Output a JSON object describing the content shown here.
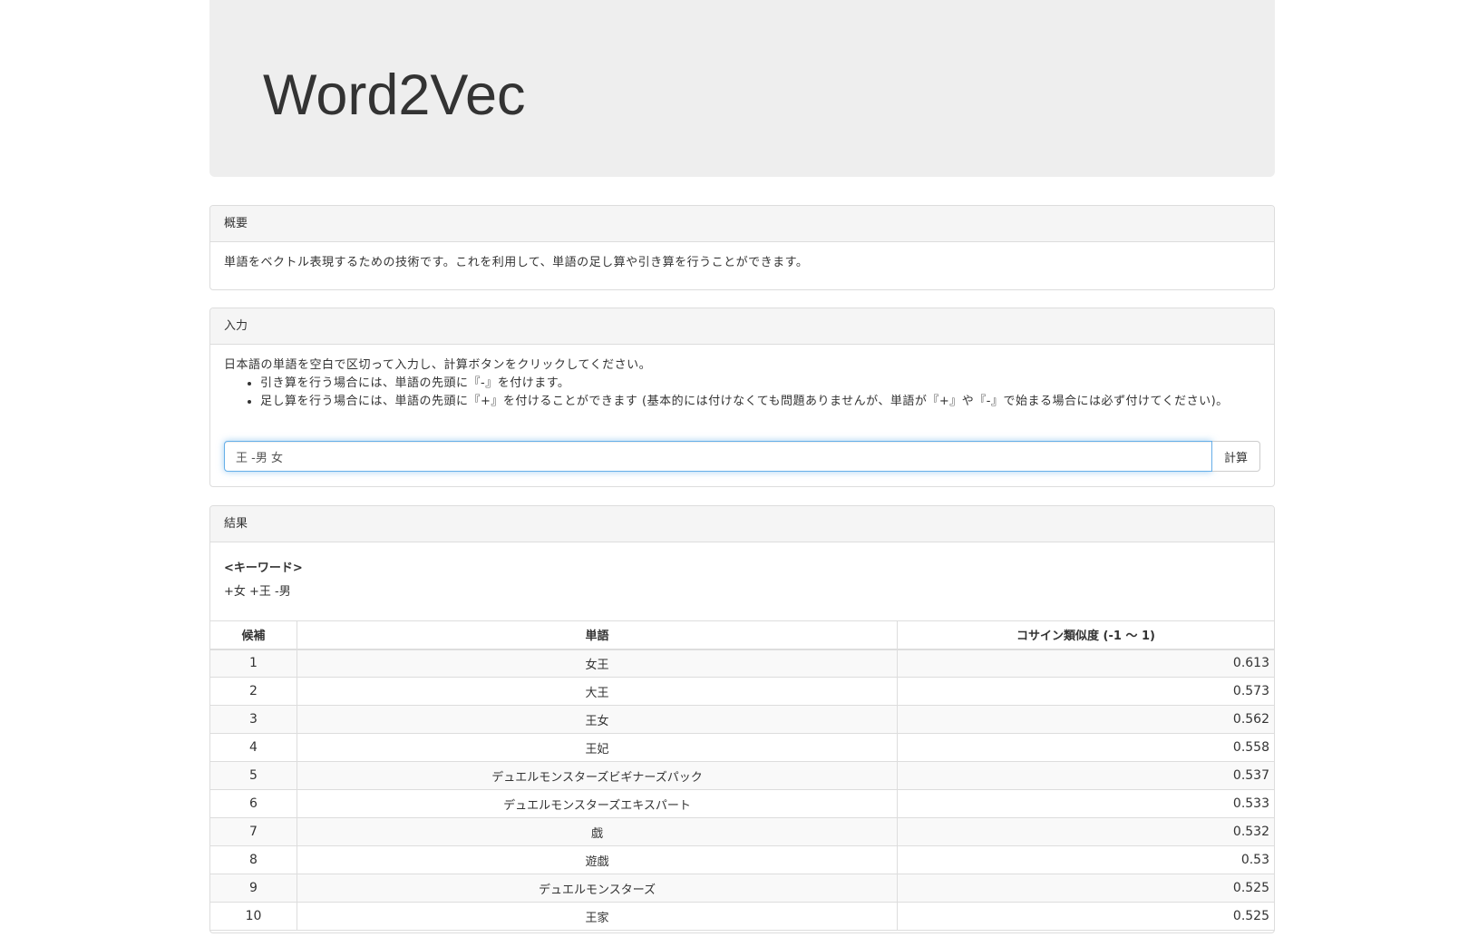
{
  "header": {
    "title": "Word2Vec"
  },
  "overview": {
    "heading": "概要",
    "text": "単語をベクトル表現するための技術です。これを利用して、単語の足し算や引き算を行うことができます。"
  },
  "input_panel": {
    "heading": "入力",
    "instruction": "日本語の単語を空白で区切って入力し、計算ボタンをクリックしてください。",
    "bullets": [
      "引き算を行う場合には、単語の先頭に『-』を付けます。",
      "足し算を行う場合には、単語の先頭に『+』を付けることができます (基本的には付けなくても問題ありませんが、単語が『+』や『-』で始まる場合には必ず付けてください)。"
    ],
    "query_value": "王 -男 女",
    "submit_label": "計算"
  },
  "result_panel": {
    "heading": "結果",
    "keyword_label": "<キーワード>",
    "keyword_value": "+女 +王 -男",
    "table": {
      "headers": [
        "候補",
        "単語",
        "コサイン類似度 (-1 〜 1)"
      ],
      "rows": [
        {
          "rank": "1",
          "word": "女王",
          "sim": "0.613"
        },
        {
          "rank": "2",
          "word": "大王",
          "sim": "0.573"
        },
        {
          "rank": "3",
          "word": "王女",
          "sim": "0.562"
        },
        {
          "rank": "4",
          "word": "王妃",
          "sim": "0.558"
        },
        {
          "rank": "5",
          "word": "デュエルモンスターズビギナーズパック",
          "sim": "0.537"
        },
        {
          "rank": "6",
          "word": "デュエルモンスターズエキスパート",
          "sim": "0.533"
        },
        {
          "rank": "7",
          "word": "戯",
          "sim": "0.532"
        },
        {
          "rank": "8",
          "word": "遊戯",
          "sim": "0.53"
        },
        {
          "rank": "9",
          "word": "デュエルモンスターズ",
          "sim": "0.525"
        },
        {
          "rank": "10",
          "word": "王家",
          "sim": "0.525"
        }
      ]
    }
  }
}
